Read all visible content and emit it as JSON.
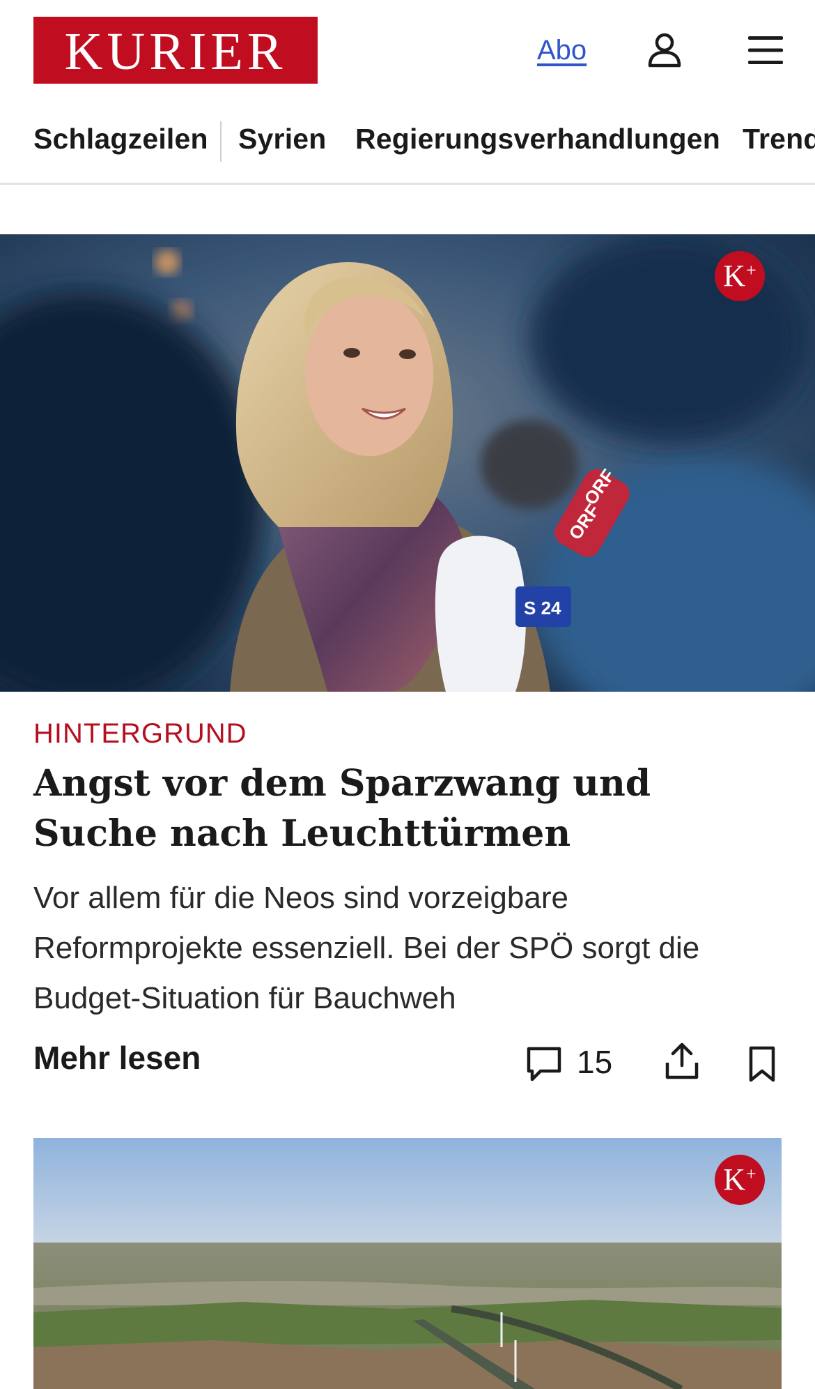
{
  "header": {
    "logo_text": "KURIER",
    "abo_label": "Abo",
    "icons": {
      "account": "user-icon",
      "menu": "hamburger-menu-icon"
    }
  },
  "nav": {
    "items": [
      {
        "label": "Schlagzeilen"
      },
      {
        "label": "Syrien"
      },
      {
        "label": "Regierungsverhandlungen"
      },
      {
        "label": "Trend"
      }
    ]
  },
  "premium_badge": {
    "text": "K",
    "plus": "+"
  },
  "article": {
    "kicker": "HINTERGRUND",
    "headline": "Angst vor dem Sparzwang und Suche nach Leuchttürmen",
    "teaser": "Vor allem für die Neos sind vorzeigbare Reformprojekte essenziell. Bei der SPÖ sorgt die Budget-Situation für Bauchweh",
    "more_label": "Mehr lesen",
    "comment_count": "15",
    "icons": {
      "comments": "comment-icon",
      "share": "share-icon",
      "bookmark": "bookmark-icon"
    },
    "image_microphone_labels": [
      "ORF",
      "ORF",
      "S 24"
    ]
  },
  "colors": {
    "brand_red": "#c00d1f",
    "kicker_red": "#b5101f",
    "link_blue": "#2f55c9"
  }
}
